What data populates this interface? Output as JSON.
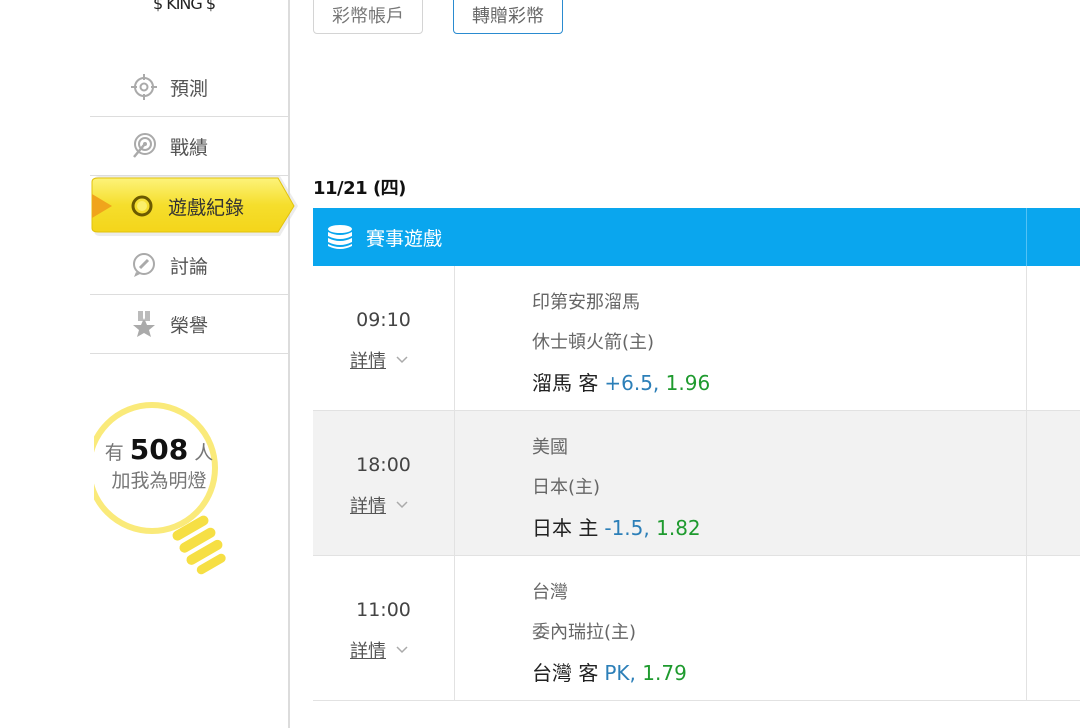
{
  "user": {
    "name": "$ KING $"
  },
  "sidebar": {
    "items": [
      {
        "label": "預測",
        "icon": "crosshair-icon"
      },
      {
        "label": "戰績",
        "icon": "target-icon"
      },
      {
        "label": "遊戲紀錄",
        "icon": "ring-icon",
        "active": true
      },
      {
        "label": "討論",
        "icon": "chat-bubble-icon"
      },
      {
        "label": "榮譽",
        "icon": "medal-star-icon"
      }
    ],
    "fans": {
      "prefix": "有",
      "count": "508",
      "unit": "人",
      "suffix": "加我為明燈"
    }
  },
  "tabs": {
    "coin_account": "彩幣帳戶",
    "transfer_coins": "轉贈彩幣"
  },
  "date": "11/21 (四)",
  "table": {
    "header": "賽事遊戲",
    "games": [
      {
        "time": "09:10",
        "detail": "詳情",
        "team1": "印第安那溜馬",
        "team2": "休士頓火箭(主)",
        "pick": "溜馬 客",
        "line": "+6.5,",
        "odds": "1.96"
      },
      {
        "time": "18:00",
        "detail": "詳情",
        "team1": "美國",
        "team2": "日本(主)",
        "pick": "日本 主",
        "line": "-1.5,",
        "odds": "1.82"
      },
      {
        "time": "11:00",
        "detail": "詳情",
        "team1": "台灣",
        "team2": "委內瑞拉(主)",
        "pick": "台灣 客",
        "line": "PK,",
        "odds": "1.79"
      }
    ]
  },
  "colors": {
    "header_blue": "#0aa6ee",
    "active_yellow": "#f7e54a",
    "odds_green": "#1e9a2e",
    "line_blue": "#2c7fb8"
  }
}
